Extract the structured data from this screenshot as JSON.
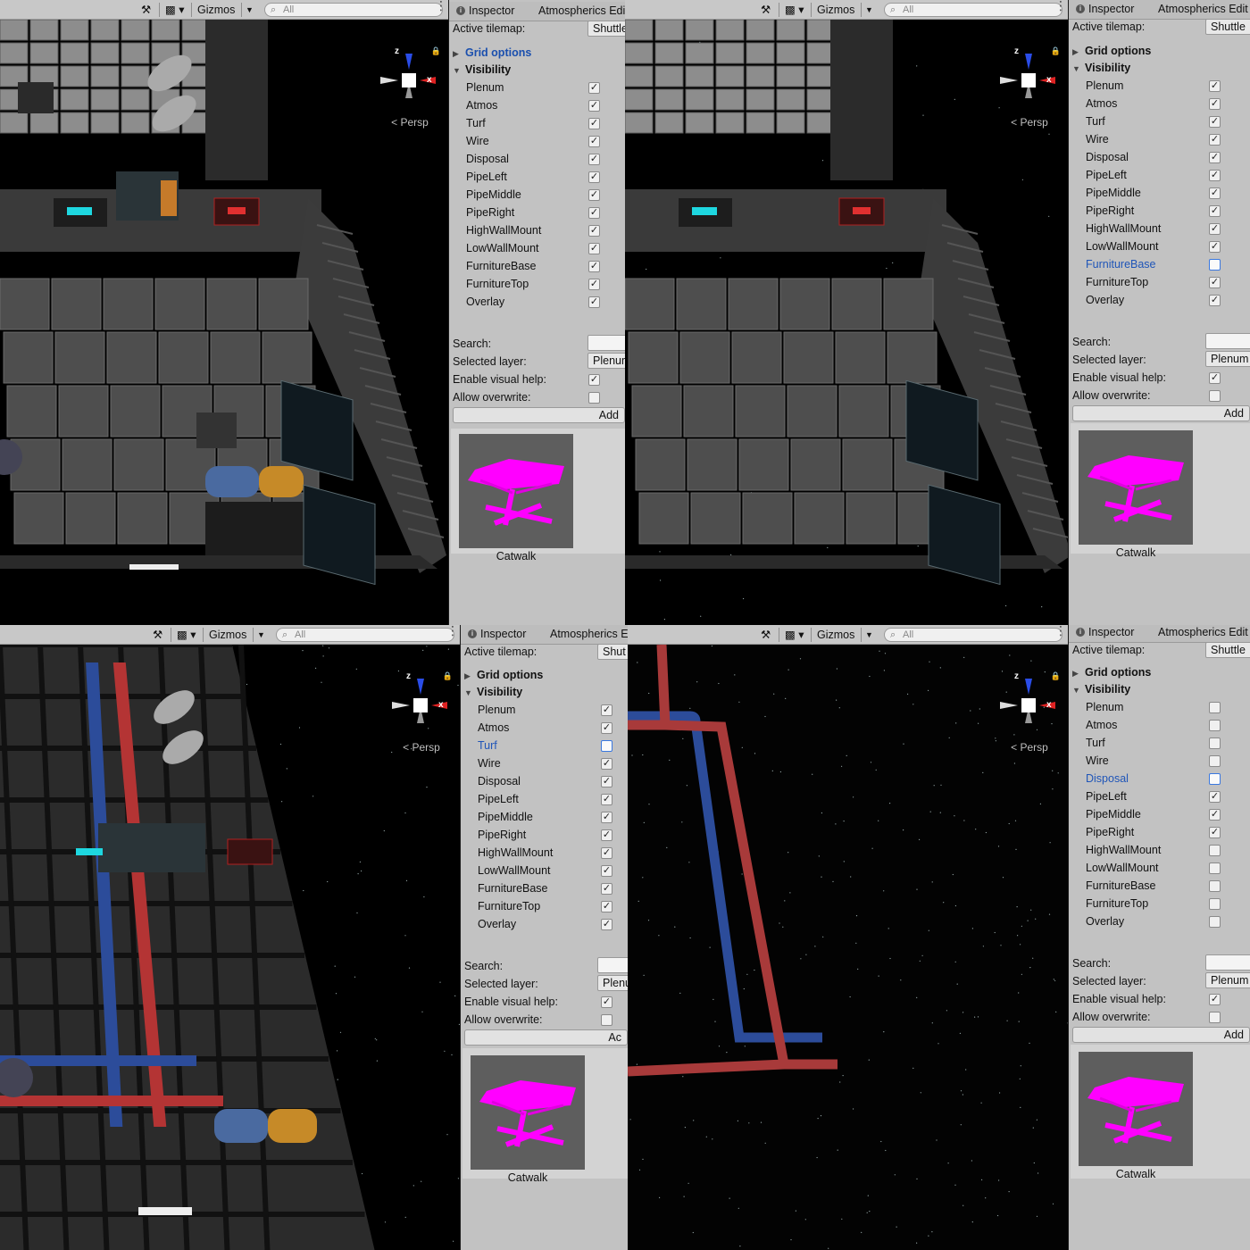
{
  "toolbar": {
    "gizmos_label": "Gizmos",
    "search_placeholder": "All",
    "persp_label": "Persp",
    "axis_z": "z",
    "axis_x": "x"
  },
  "inspector": {
    "tab_label": "Inspector",
    "editor_tab_label": "Atmospherics Edit",
    "active_tilemap_label": "Active tilemap:",
    "active_tilemap_value": "Shuttle",
    "grid_options_label": "Grid options",
    "visibility_label": "Visibility",
    "search_label": "Search:",
    "selected_layer_label": "Selected layer:",
    "selected_layer_value": "Plenum",
    "visual_help_label": "Enable visual help:",
    "overwrite_label": "Allow overwrite:",
    "add_button_label": "Add",
    "preview_caption": "Catwalk"
  },
  "layer_names": [
    "Plenum",
    "Atmos",
    "Turf",
    "Wire",
    "Disposal",
    "PipeLeft",
    "PipeMiddle",
    "PipeRight",
    "HighWallMount",
    "LowWallMount",
    "FurnitureBase",
    "FurnitureTop",
    "Overlay"
  ],
  "panels": [
    {
      "tab_right": "Atmospherics Edi",
      "active_tilemap_value": "Shuttle",
      "selected_layer_value": "Plenum",
      "add_label": "Add",
      "grid_options_highlighted": true,
      "visible": [
        true,
        true,
        true,
        true,
        true,
        true,
        true,
        true,
        true,
        true,
        true,
        true,
        true
      ],
      "highlighted_layer": -1,
      "visual_help": true,
      "overwrite": false
    },
    {
      "tab_right": "Atmospherics Edit",
      "active_tilemap_value": "Shuttle",
      "selected_layer_value": "Plenum",
      "add_label": "Add",
      "grid_options_highlighted": false,
      "visible": [
        true,
        true,
        true,
        true,
        true,
        true,
        true,
        true,
        true,
        true,
        false,
        true,
        true
      ],
      "highlighted_layer": 10,
      "visual_help": true,
      "overwrite": false
    },
    {
      "tab_right": "Atmospherics E",
      "active_tilemap_value": "Shut",
      "selected_layer_value": "Plenu",
      "add_label": "Ac",
      "grid_options_highlighted": false,
      "visible": [
        true,
        true,
        false,
        true,
        true,
        true,
        true,
        true,
        true,
        true,
        true,
        true,
        true
      ],
      "highlighted_layer": 2,
      "visual_help": true,
      "overwrite": false
    },
    {
      "tab_right": "Atmospherics Edit",
      "active_tilemap_value": "Shuttle",
      "selected_layer_value": "Plenum",
      "add_label": "Add",
      "grid_options_highlighted": false,
      "visible": [
        false,
        false,
        false,
        false,
        false,
        true,
        true,
        true,
        false,
        false,
        false,
        false,
        false
      ],
      "highlighted_layer": 4,
      "visual_help": true,
      "overwrite": false
    }
  ],
  "colors": {
    "preview_magenta": "#ff00ff",
    "pipe_red": "#a83a3a",
    "pipe_blue": "#2c4c9a",
    "link_blue": "#1f55b8"
  },
  "icons": {
    "tools": "tools-icon",
    "camera": "camera-icon",
    "search": "search-icon",
    "info": "info-icon",
    "lock": "lock-icon",
    "menu": "menu-dots-icon"
  }
}
